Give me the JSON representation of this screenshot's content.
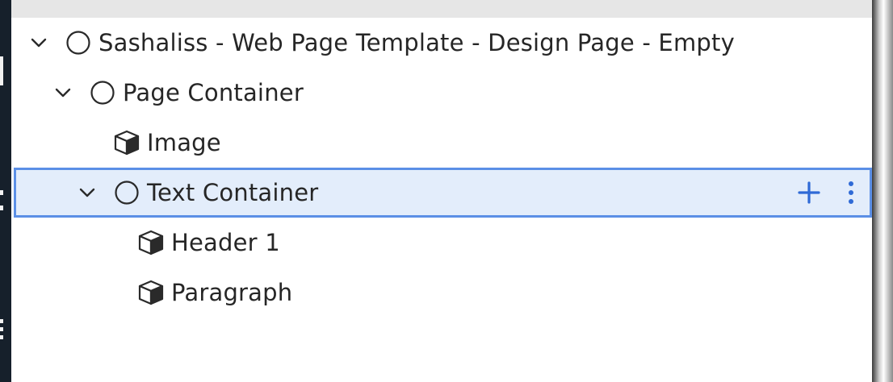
{
  "accent_color": "#5b8fe6",
  "selection_background": "#e3edfb",
  "tree": {
    "nodes": [
      {
        "label": "Sashaliss - Web Page Template - Design Page - Empty",
        "icon": "circle-icon",
        "expanded": true
      },
      {
        "label": "Page Container",
        "icon": "circle-icon",
        "expanded": true
      },
      {
        "label": "Image",
        "icon": "cube-icon"
      },
      {
        "label": "Text Container",
        "icon": "circle-icon",
        "expanded": true,
        "selected": true
      },
      {
        "label": "Header 1",
        "icon": "cube-icon"
      },
      {
        "label": "Paragraph",
        "icon": "cube-icon"
      }
    ],
    "row_actions": {
      "add_icon": "plus-icon",
      "more_icon": "more-vertical-icon"
    }
  }
}
